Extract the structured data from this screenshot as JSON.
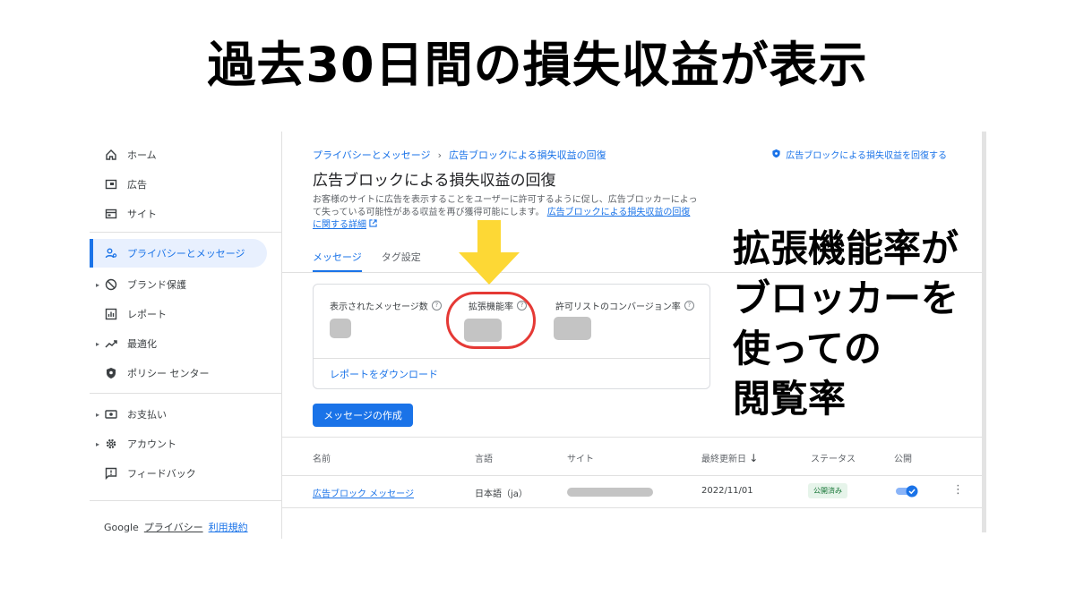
{
  "headline": "過去30日間の損失収益が表示",
  "annotation": {
    "lines": [
      "拡張機能率が",
      "ブロッカーを",
      "使っての",
      "閲覧率"
    ],
    "arrow_color": "#fdd835",
    "circle_color": "#e53935"
  },
  "sidebar": {
    "items": [
      {
        "label": "ホーム",
        "icon": "home-icon"
      },
      {
        "label": "広告",
        "icon": "ads-icon"
      },
      {
        "label": "サイト",
        "icon": "sites-icon"
      },
      {
        "label": "プライバシーとメッセージ",
        "icon": "privacy-icon",
        "active": true
      },
      {
        "label": "ブランド保護",
        "icon": "block-icon"
      },
      {
        "label": "レポート",
        "icon": "report-icon"
      },
      {
        "label": "最適化",
        "icon": "trend-icon"
      },
      {
        "label": "ポリシー センター",
        "icon": "shield-icon"
      },
      {
        "label": "お支払い",
        "icon": "payments-icon"
      },
      {
        "label": "アカウント",
        "icon": "gear-icon"
      },
      {
        "label": "フィードバック",
        "icon": "feedback-icon"
      }
    ],
    "footer": {
      "brand": "Google",
      "privacy": "プライバシー",
      "terms": "利用規約"
    }
  },
  "main": {
    "breadcrumb": {
      "parent": "プライバシーとメッセージ",
      "current": "広告ブロックによる損失収益の回復"
    },
    "top_link": "広告ブロックによる損失収益を回復する",
    "title": "広告ブロックによる損失収益の回復",
    "description": "お客様のサイトに広告を表示することをユーザーに許可するように促し、広告ブロッカーによって失っている可能性がある収益を再び獲得可能にします。",
    "description_link": "広告ブロックによる損失収益の回復に関する詳細",
    "tabs": [
      "メッセージ",
      "タグ設定"
    ],
    "metrics": [
      "表示されたメッセージ数",
      "拡張機能率",
      "許可リストのコンバージョン率"
    ],
    "download_link": "レポートをダウンロード",
    "create_button": "メッセージの作成",
    "table": {
      "headers": [
        "名前",
        "言語",
        "サイト",
        "最終更新日",
        "ステータス",
        "公開"
      ],
      "rows": [
        {
          "name": "広告ブロック メッセージ",
          "language": "日本語（ja）",
          "site": "",
          "updated": "2022/11/01",
          "status": "公開済み",
          "published": true
        }
      ]
    }
  }
}
